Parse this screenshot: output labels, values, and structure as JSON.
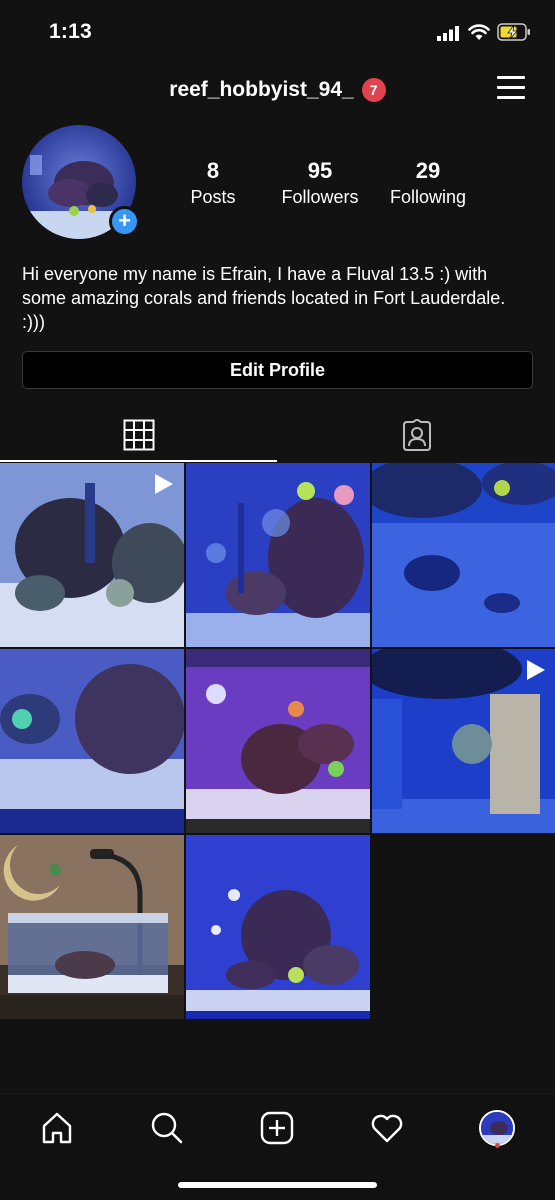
{
  "status_bar": {
    "time": "1:13"
  },
  "header": {
    "username": "reef_hobbyist_94_",
    "notification_count": "7"
  },
  "profile": {
    "stats": [
      {
        "value": "8",
        "label": "Posts"
      },
      {
        "value": "95",
        "label": "Followers"
      },
      {
        "value": "29",
        "label": "Following"
      }
    ],
    "bio": "Hi everyone my name is Efrain, I have a Fluval 13.5 :) with some amazing corals and friends located in Fort Lauderdale. :)))",
    "edit_button_label": "Edit Profile"
  },
  "tabs": [
    {
      "icon": "grid-icon",
      "active": true
    },
    {
      "icon": "tagged-icon",
      "active": false
    }
  ],
  "posts": [
    {
      "is_video": true
    },
    {
      "is_video": false
    },
    {
      "is_video": false
    },
    {
      "is_video": false
    },
    {
      "is_video": false
    },
    {
      "is_video": true
    },
    {
      "is_video": false
    },
    {
      "is_video": false
    }
  ],
  "bottom_nav": [
    {
      "icon": "home-icon"
    },
    {
      "icon": "search-icon"
    },
    {
      "icon": "add-post-icon"
    },
    {
      "icon": "heart-icon"
    },
    {
      "icon": "profile-avatar"
    }
  ],
  "colors": {
    "background": "#121212",
    "badge": "#e0434e",
    "accent_blue": "#3897f0"
  }
}
